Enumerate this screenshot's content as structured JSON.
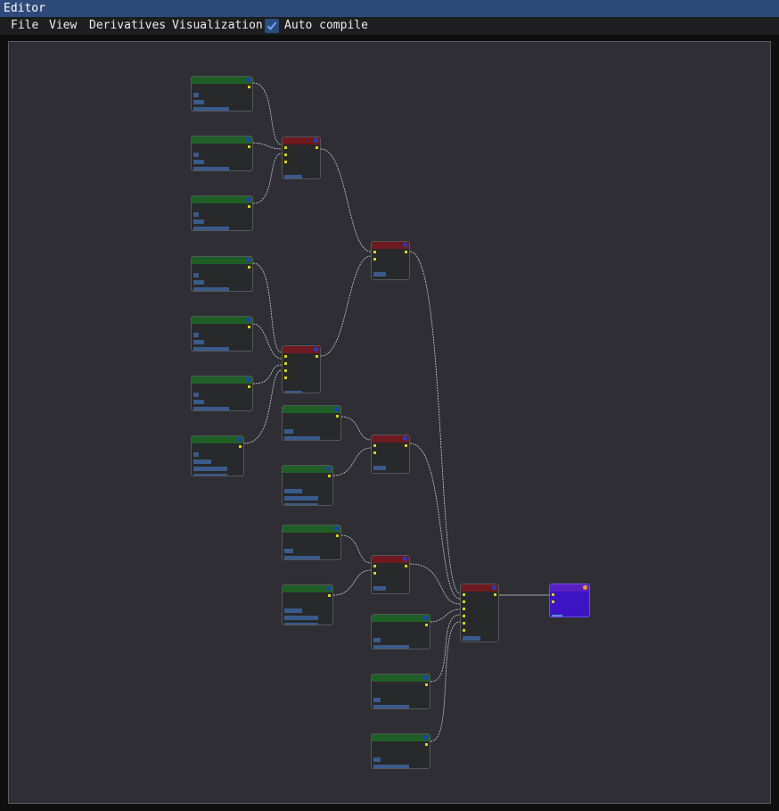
{
  "window": {
    "title": "Editor"
  },
  "menu": {
    "items": [
      "File",
      "View",
      "Derivatives",
      "Visualization"
    ],
    "auto_compile_label": "Auto compile",
    "auto_compile_checked": true
  },
  "colors": {
    "accent": "#2d4a7a",
    "node_green": "#1f5f26",
    "node_red": "#6e1a20",
    "node_purple": "#3d14c4",
    "wire": "#d0d0d0",
    "pin": "#d8d020"
  }
}
